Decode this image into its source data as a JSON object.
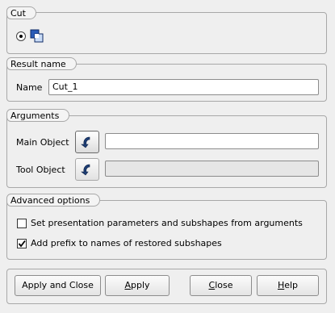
{
  "cut": {
    "title": "Cut",
    "op_icon": "boolean-cut-icon",
    "radio_selected": true
  },
  "result": {
    "title": "Result name",
    "name_label": "Name",
    "name_value": "Cut_1"
  },
  "arguments": {
    "title": "Arguments",
    "main_label": "Main Object",
    "main_value": "",
    "main_select_icon": "select-arrow-icon",
    "tool_label": "Tool Object",
    "tool_value": "",
    "tool_select_icon": "select-arrow-icon"
  },
  "advanced": {
    "title": "Advanced options",
    "opt1_label": "Set presentation parameters and subshapes from arguments",
    "opt1_checked": false,
    "opt2_label": "Add prefix to names of restored subshapes",
    "opt2_checked": true
  },
  "buttons": {
    "apply_close": "Apply and Close",
    "apply_first": "A",
    "apply_rest": "pply",
    "close_first": "C",
    "close_rest": "lose",
    "help_first": "H",
    "help_rest": "elp"
  }
}
